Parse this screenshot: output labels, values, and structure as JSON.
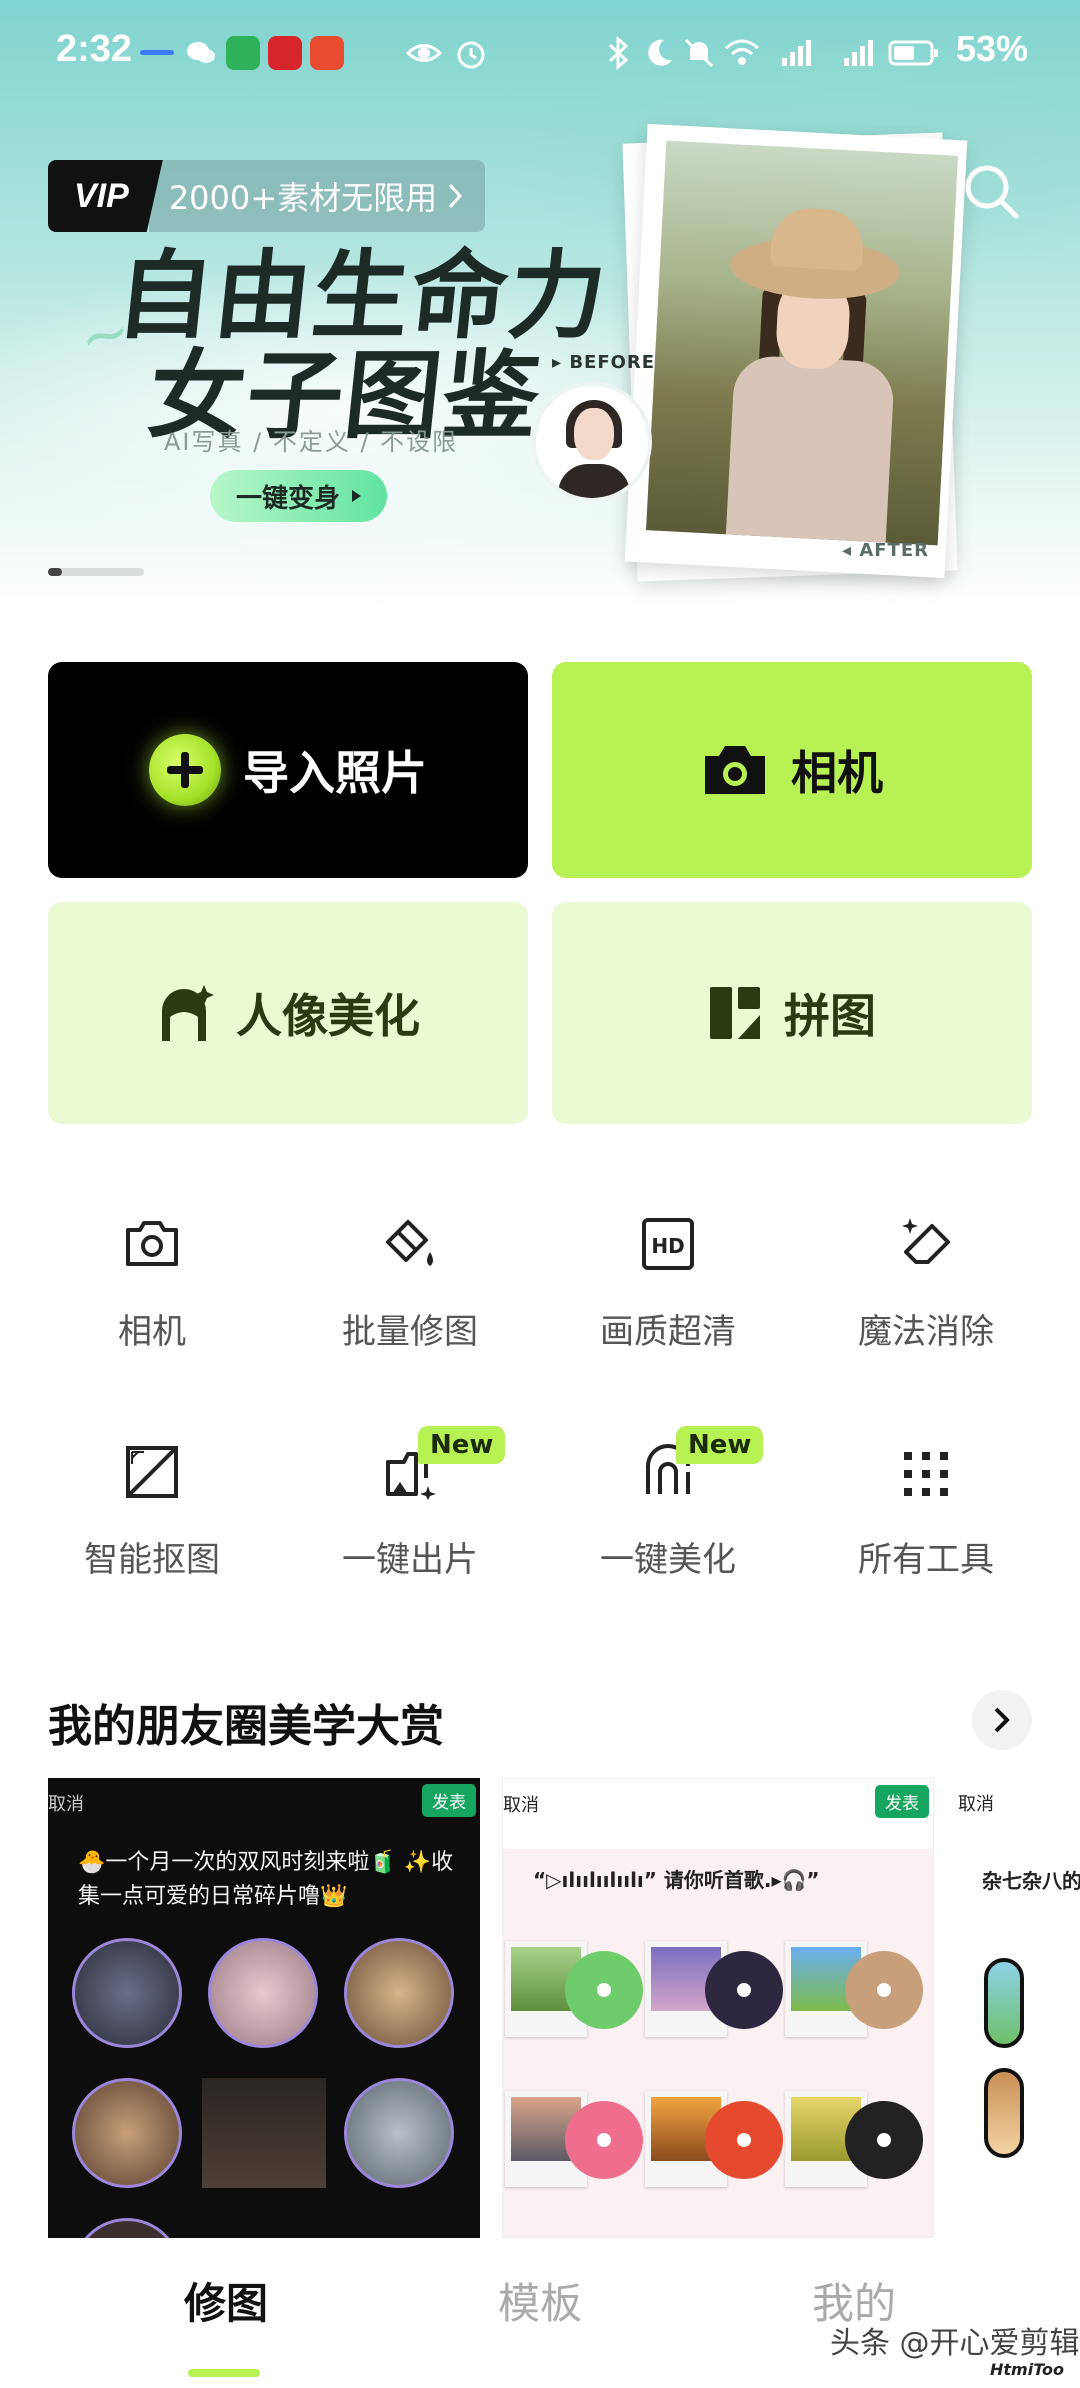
{
  "status_bar": {
    "time": "2:32",
    "battery": "53%"
  },
  "banner": {
    "vip_tag": "VIP",
    "vip_text": "2000+素材无限用",
    "title_line1": "自由生命力",
    "title_line2": "女子图鉴",
    "tags": "AI写真  /  不定义  /  不设限",
    "cta": "一键变身",
    "before_label": "BEFORE",
    "after_label": "AFTER"
  },
  "actions": {
    "import": "导入照片",
    "camera": "相机",
    "portrait": "人像美化",
    "collage": "拼图"
  },
  "tools": [
    {
      "label": "相机",
      "icon": "camera-icon"
    },
    {
      "label": "批量修图",
      "icon": "batch-edit-icon"
    },
    {
      "label": "画质超清",
      "icon": "hd-icon"
    },
    {
      "label": "魔法消除",
      "icon": "magic-eraser-icon"
    },
    {
      "label": "智能抠图",
      "icon": "cutout-icon"
    },
    {
      "label": "一键出片",
      "icon": "one-click-output-icon",
      "badge": "New"
    },
    {
      "label": "一键美化",
      "icon": "one-click-beautify-icon",
      "badge": "New"
    },
    {
      "label": "所有工具",
      "icon": "all-tools-icon"
    }
  ],
  "gallery": {
    "title": "我的朋友圈美学大赏",
    "posts": [
      {
        "cancel": "取消",
        "publish": "发表",
        "caption": "🐣一个月一次的双风时刻来啦🧃 ✨收集一点可爱的日常碎片噜👑"
      },
      {
        "cancel": "取消",
        "publish": "发表",
        "caption": "“▷ılıılıılıılı” 请你听首歌.▸🎧”"
      },
      {
        "cancel": "取消",
        "caption": "杂七杂八的"
      }
    ]
  },
  "bottom_nav": {
    "tabs": [
      "修图",
      "模板",
      "我的"
    ]
  },
  "watermark": {
    "text": "头条 @开心爱剪辑",
    "brand": "HtmiToo"
  },
  "colors": {
    "accent_green": "#b8f153",
    "light_green": "#eafad3",
    "dark": "#000000"
  }
}
